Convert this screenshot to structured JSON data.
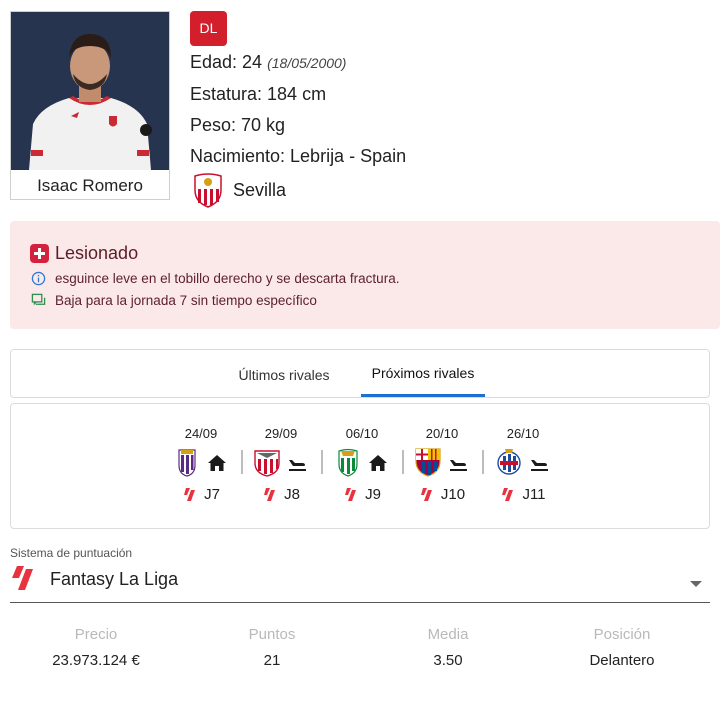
{
  "player": {
    "name": "Isaac Romero",
    "position_badge": "DL",
    "age_label": "Edad: 24",
    "dob": "(18/05/2000)",
    "height": "Estatura: 184 cm",
    "weight": "Peso: 70 kg",
    "birthplace": "Nacimiento: Lebrija - Spain",
    "team": "Sevilla",
    "team_crest_icon": "sevilla-crest"
  },
  "injury": {
    "status": "Lesionado",
    "detail": "esguince leve en el tobillo derecho y se descarta fractura.",
    "note": "Baja para la jornada 7 sin tiempo específico",
    "color": "#d4213d"
  },
  "tabs": [
    {
      "label": "Últimos rivales",
      "active": false
    },
    {
      "label": "Próximos rivales",
      "active": true
    }
  ],
  "rivals": [
    {
      "date": "24/09",
      "team_icon": "valladolid-crest",
      "venue_icon": "home-icon",
      "round": "J7"
    },
    {
      "date": "29/09",
      "team_icon": "athletic-club-crest",
      "venue_icon": "away-plane-icon",
      "round": "J8"
    },
    {
      "date": "06/10",
      "team_icon": "betis-crest",
      "venue_icon": "home-icon",
      "round": "J9"
    },
    {
      "date": "20/10",
      "team_icon": "barcelona-crest",
      "venue_icon": "away-plane-icon",
      "round": "J10"
    },
    {
      "date": "26/10",
      "team_icon": "espanyol-crest",
      "venue_icon": "away-plane-icon",
      "round": "J11"
    }
  ],
  "scoring": {
    "label": "Sistema de puntuación",
    "value": "Fantasy La Liga"
  },
  "stats": [
    {
      "key": "Precio",
      "value": "23.973.124 €"
    },
    {
      "key": "Puntos",
      "value": "21"
    },
    {
      "key": "Media",
      "value": "3.50"
    },
    {
      "key": "Posición",
      "value": "Delantero"
    }
  ],
  "colors": {
    "accent_blue": "#1e6fd1",
    "badge_red": "#d21f2b",
    "injury_bg": "#fbe9ea"
  }
}
